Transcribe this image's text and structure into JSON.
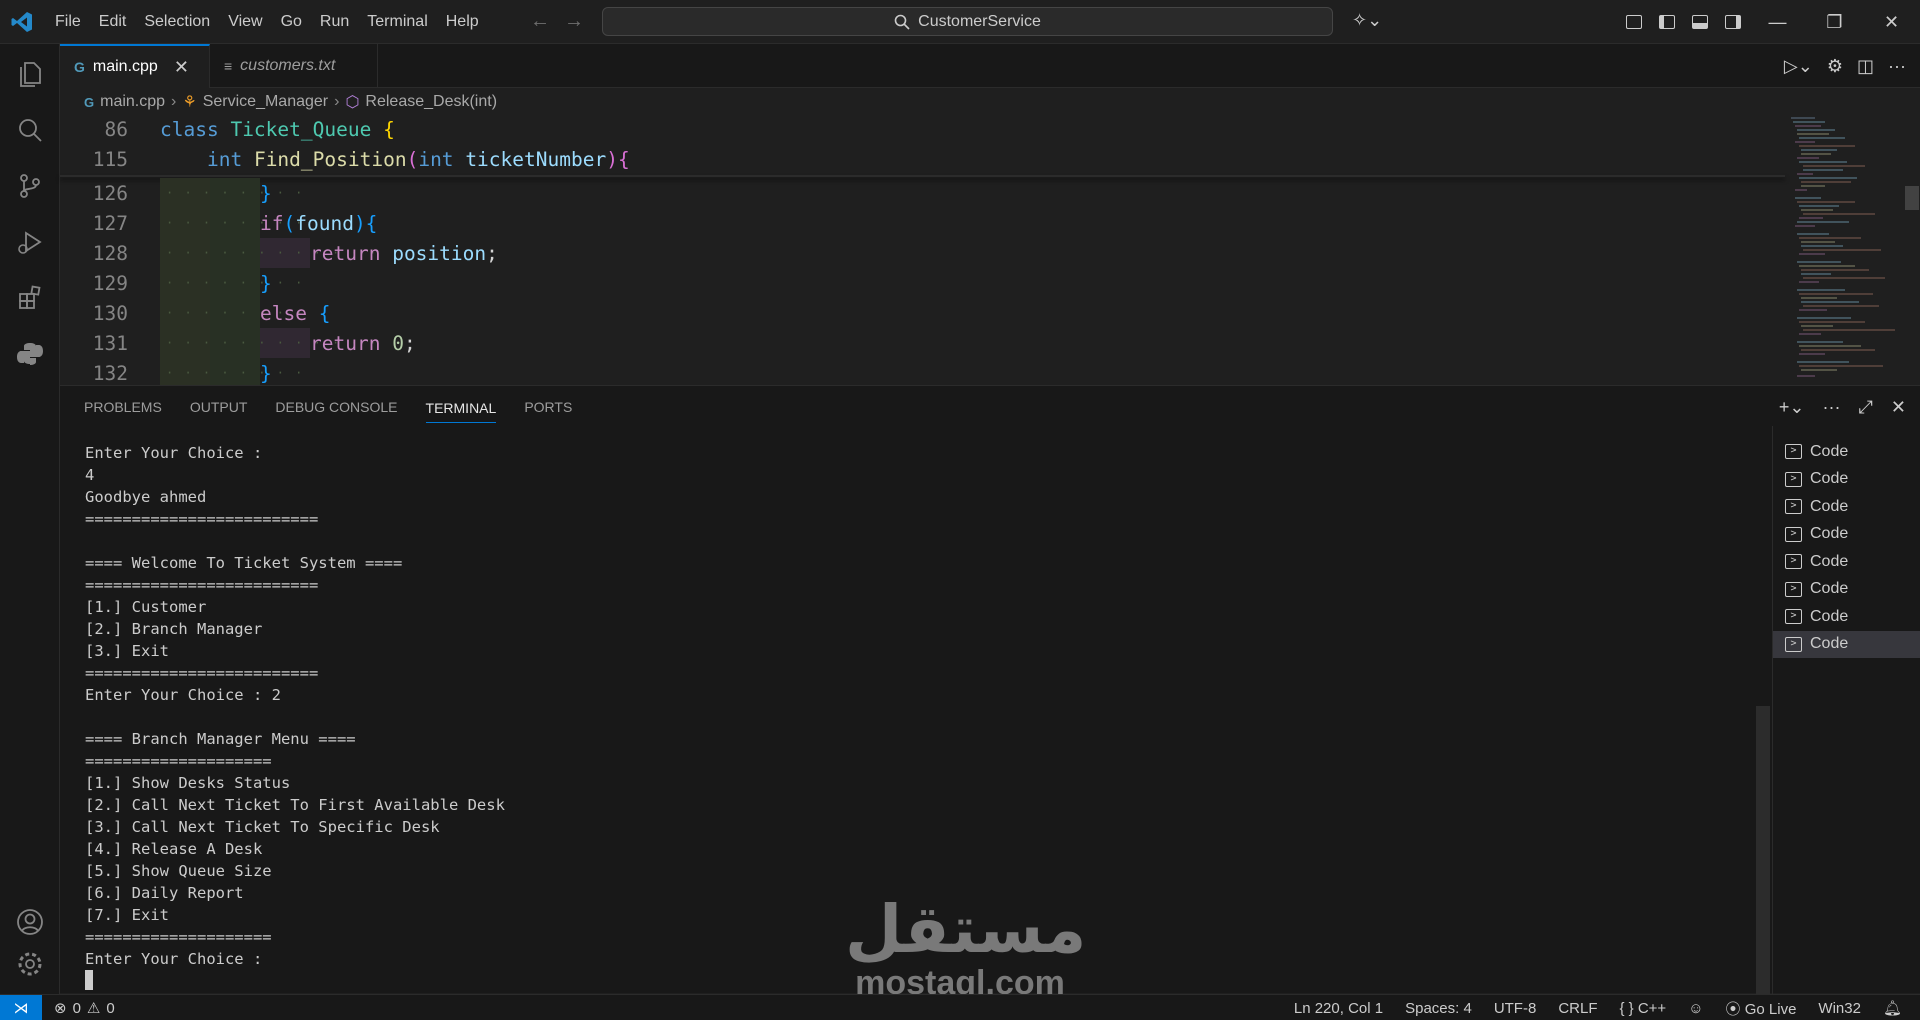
{
  "titlebar": {
    "menu": [
      "File",
      "Edit",
      "Selection",
      "View",
      "Go",
      "Run",
      "Terminal",
      "Help"
    ],
    "search_text": "CustomerService"
  },
  "tabs": [
    {
      "label": "main.cpp",
      "active": true
    },
    {
      "label": "customers.txt",
      "active": false
    }
  ],
  "breadcrumb": [
    "main.cpp",
    "Service_Manager",
    "Release_Desk(int)"
  ],
  "editor": {
    "lines": [
      {
        "n": "86"
      },
      {
        "n": "115"
      },
      {
        "n": "126"
      },
      {
        "n": "127"
      },
      {
        "n": "128"
      },
      {
        "n": "129"
      },
      {
        "n": "130"
      },
      {
        "n": "131"
      },
      {
        "n": "132"
      }
    ]
  },
  "panel": {
    "tabs": [
      "PROBLEMS",
      "OUTPUT",
      "DEBUG CONSOLE",
      "TERMINAL",
      "PORTS"
    ],
    "terminal_lines": [
      "Enter Your Choice :",
      "4",
      "Goodbye ahmed",
      "=========================",
      "",
      "==== Welcome To Ticket System ====",
      "=========================",
      "[1.] Customer",
      "[2.] Branch Manager",
      "[3.] Exit",
      "=========================",
      "Enter Your Choice : 2",
      "",
      "==== Branch Manager Menu ====",
      "====================",
      "[1.] Show Desks Status",
      "[2.] Call Next Ticket To First Available Desk",
      "[3.] Call Next Ticket To Specific Desk",
      "[4.] Release A Desk",
      "[5.] Show Queue Size",
      "[6.] Daily Report",
      "[7.] Exit",
      "====================",
      "Enter Your Choice :"
    ],
    "terminals": [
      "Code",
      "Code",
      "Code",
      "Code",
      "Code",
      "Code",
      "Code",
      "Code"
    ]
  },
  "watermark": {
    "arabic": "مستقل",
    "latin": "mostaql.com"
  },
  "statusbar": {
    "errors": "0",
    "warnings": "0",
    "position": "Ln 220, Col 1",
    "spaces": "Spaces: 4",
    "encoding": "UTF-8",
    "eol": "CRLF",
    "language": "C++",
    "golive": "Go Live",
    "platform": "Win32"
  },
  "colors": {
    "accent": "#0078d4",
    "background": "#1f1f1f"
  }
}
